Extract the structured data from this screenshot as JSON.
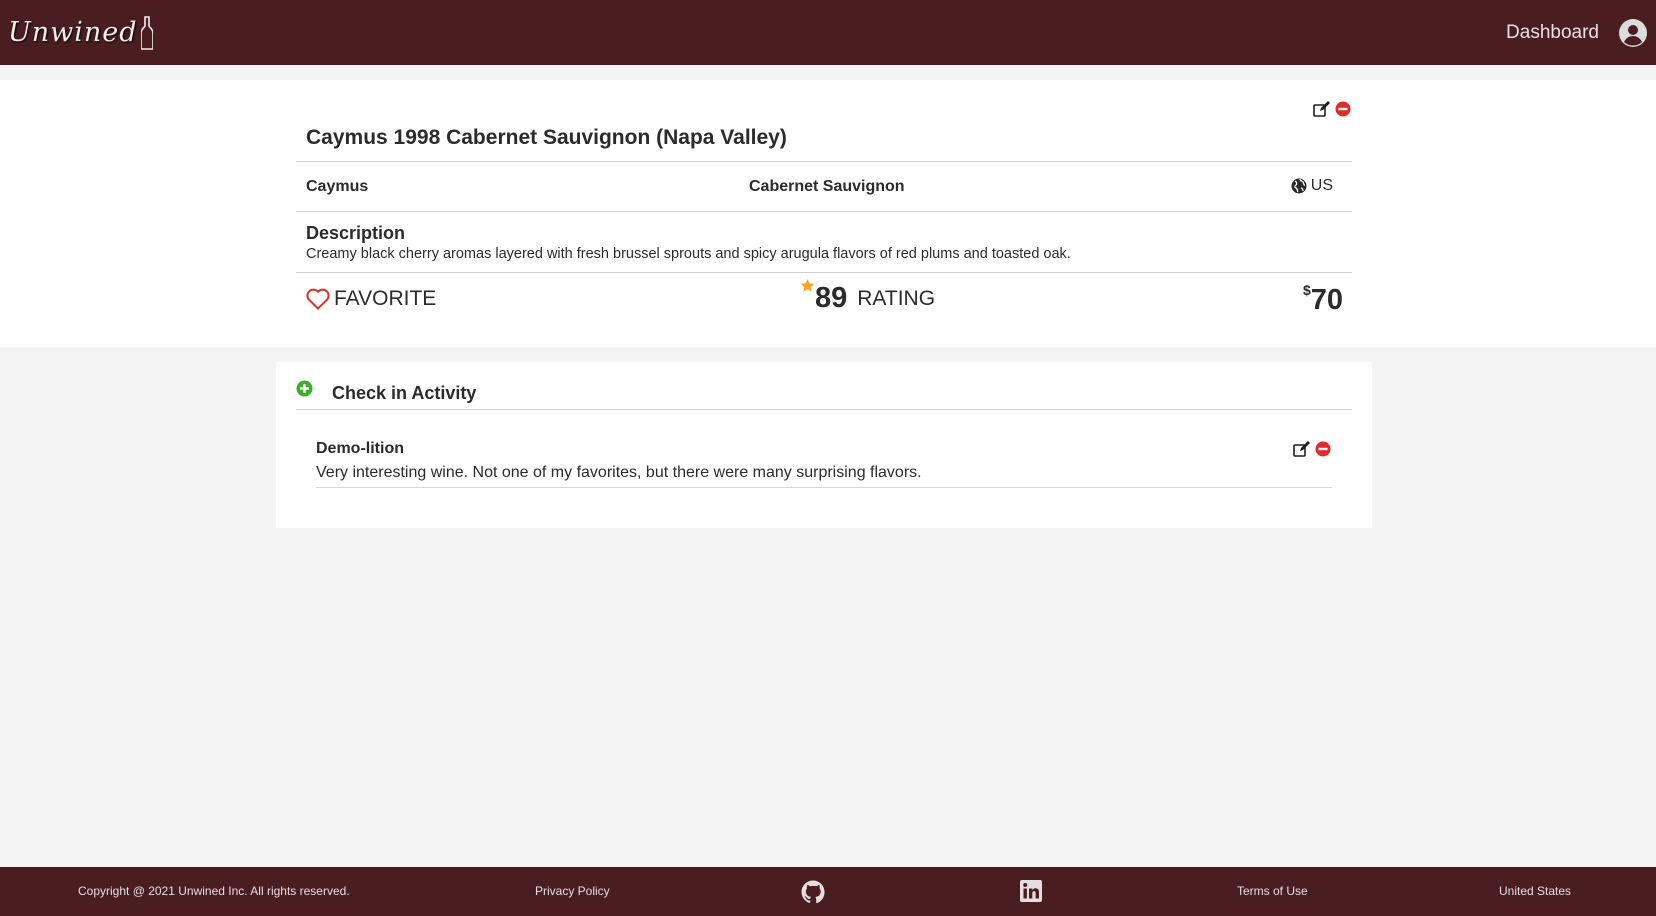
{
  "navbar": {
    "logo_text": "Unwined",
    "dashboard_label": "Dashboard"
  },
  "wine": {
    "title": "Caymus 1998 Cabernet Sauvignon (Napa Valley)",
    "winery": "Caymus",
    "variety": "Cabernet Sauvignon",
    "country": "US",
    "description_label": "Description",
    "description": "Creamy black cherry aromas layered with fresh brussel sprouts and spicy arugula flavors of red plums and toasted oak.",
    "favorite_label": "FAVORITE",
    "rating": "89",
    "rating_label": "RATING",
    "price_symbol": "$",
    "price": "70"
  },
  "activity": {
    "title": "Check in Activity",
    "checkins": [
      {
        "user": "Demo-lition",
        "text": "Very interesting wine. Not one of my favorites, but there were many surprising flavors."
      }
    ]
  },
  "footer": {
    "copyright": "Copyright @ 2021 Unwined Inc. All rights reserved.",
    "privacy": "Privacy Policy",
    "terms": "Terms of Use",
    "country": "United States"
  },
  "colors": {
    "brand": "#4a1e21",
    "delete": "#e02b2b",
    "add": "#3dae2b",
    "star": "#f5a623",
    "heart": "#d9312b"
  }
}
